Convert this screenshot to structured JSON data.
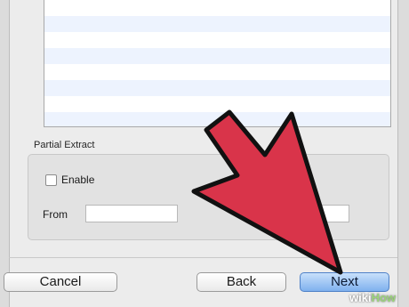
{
  "colors": {
    "list_stripe": "#edf3fe",
    "default_button": "#7fb1ee",
    "arrow_fill": "#d9344a"
  },
  "file_list": {
    "row_count": 8
  },
  "partial_extract": {
    "title": "Partial Extract",
    "enable_label": "Enable",
    "enable_checked": false,
    "from_label": "From",
    "from_value": "",
    "to_value": ""
  },
  "buttons": {
    "cancel": "Cancel",
    "back": "Back",
    "next": "Next"
  },
  "watermark": {
    "part1": "wiki",
    "part2": "How"
  }
}
